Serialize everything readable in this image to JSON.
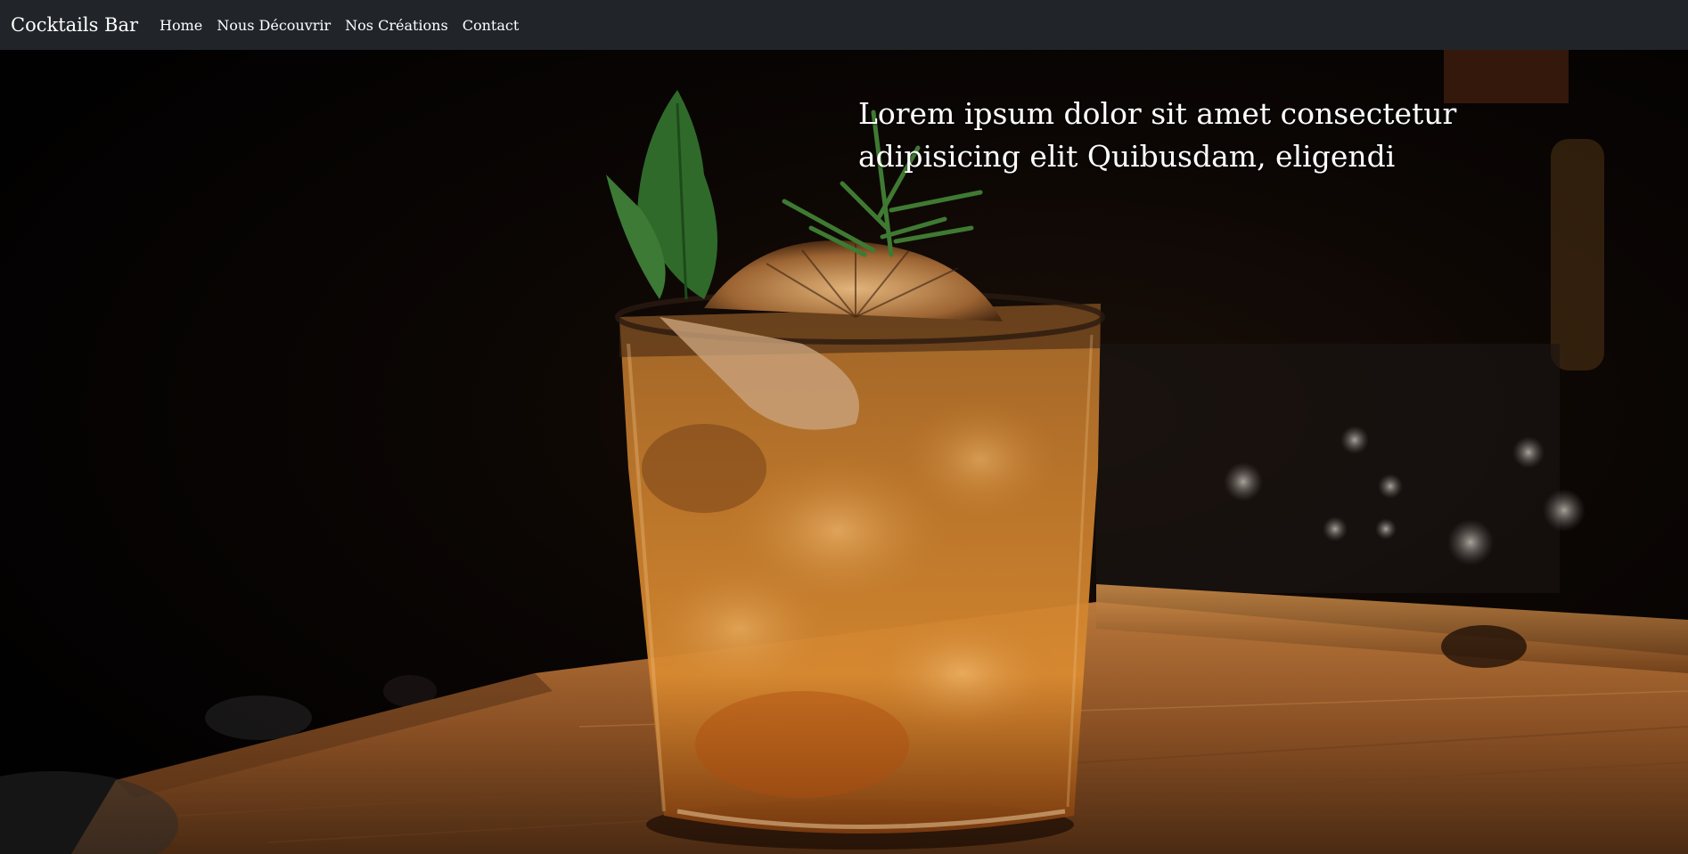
{
  "navbar": {
    "brand": "Cocktails Bar",
    "links": [
      {
        "label": "Home"
      },
      {
        "label": "Nous Découvrir"
      },
      {
        "label": "Nos Créations"
      },
      {
        "label": "Contact"
      }
    ]
  },
  "hero": {
    "title": "Lorem ipsum dolor sit amet consectetur adipisicing elit Quibusdam, eligendi"
  },
  "colors": {
    "navbar_bg": "#212529",
    "text": "#ffffff"
  }
}
